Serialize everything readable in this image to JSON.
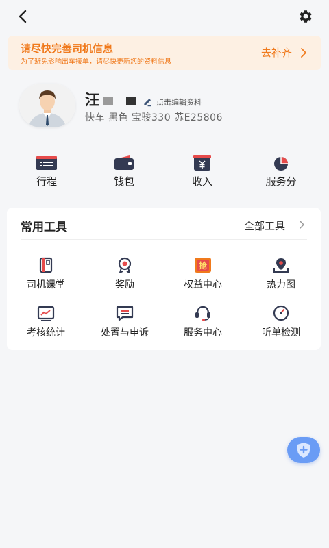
{
  "topbar": {
    "back_icon": "chevron-left-icon",
    "settings_icon": "gear-icon"
  },
  "notice": {
    "title": "请尽快完善司机信息",
    "subtitle": "为了避免影响出车接单，请尽快更新您的资料信息",
    "action": "去补齐",
    "color": "#f07a1d",
    "background": "#fdf0e3"
  },
  "profile": {
    "surname": "汪",
    "edit_link": "点击编辑资料",
    "car_info": "快车  黑色  宝骏330   苏E25806"
  },
  "quick_actions": [
    {
      "label": "行程",
      "icon": "trip-list-icon"
    },
    {
      "label": "钱包",
      "icon": "wallet-icon"
    },
    {
      "label": "收入",
      "icon": "income-yen-icon"
    },
    {
      "label": "服务分",
      "icon": "pie-chart-icon"
    }
  ],
  "tools": {
    "title": "常用工具",
    "all_label": "全部工具",
    "items": [
      {
        "label": "司机课堂",
        "icon": "book-icon"
      },
      {
        "label": "奖励",
        "icon": "medal-icon"
      },
      {
        "label": "权益中心",
        "icon": "grab-badge-icon",
        "badge": "抢"
      },
      {
        "label": "热力图",
        "icon": "map-pin-icon"
      },
      {
        "label": "考核统计",
        "icon": "line-chart-icon"
      },
      {
        "label": "处置与申诉",
        "icon": "message-icon"
      },
      {
        "label": "服务中心",
        "icon": "headset-icon"
      },
      {
        "label": "听单检测",
        "icon": "gauge-icon"
      }
    ]
  },
  "fab": {
    "icon": "shield-plus-icon",
    "color": "#6a9cf5"
  },
  "colors": {
    "accent_red": "#e64b4b",
    "navy": "#333a52",
    "orange": "#f07a1d"
  }
}
